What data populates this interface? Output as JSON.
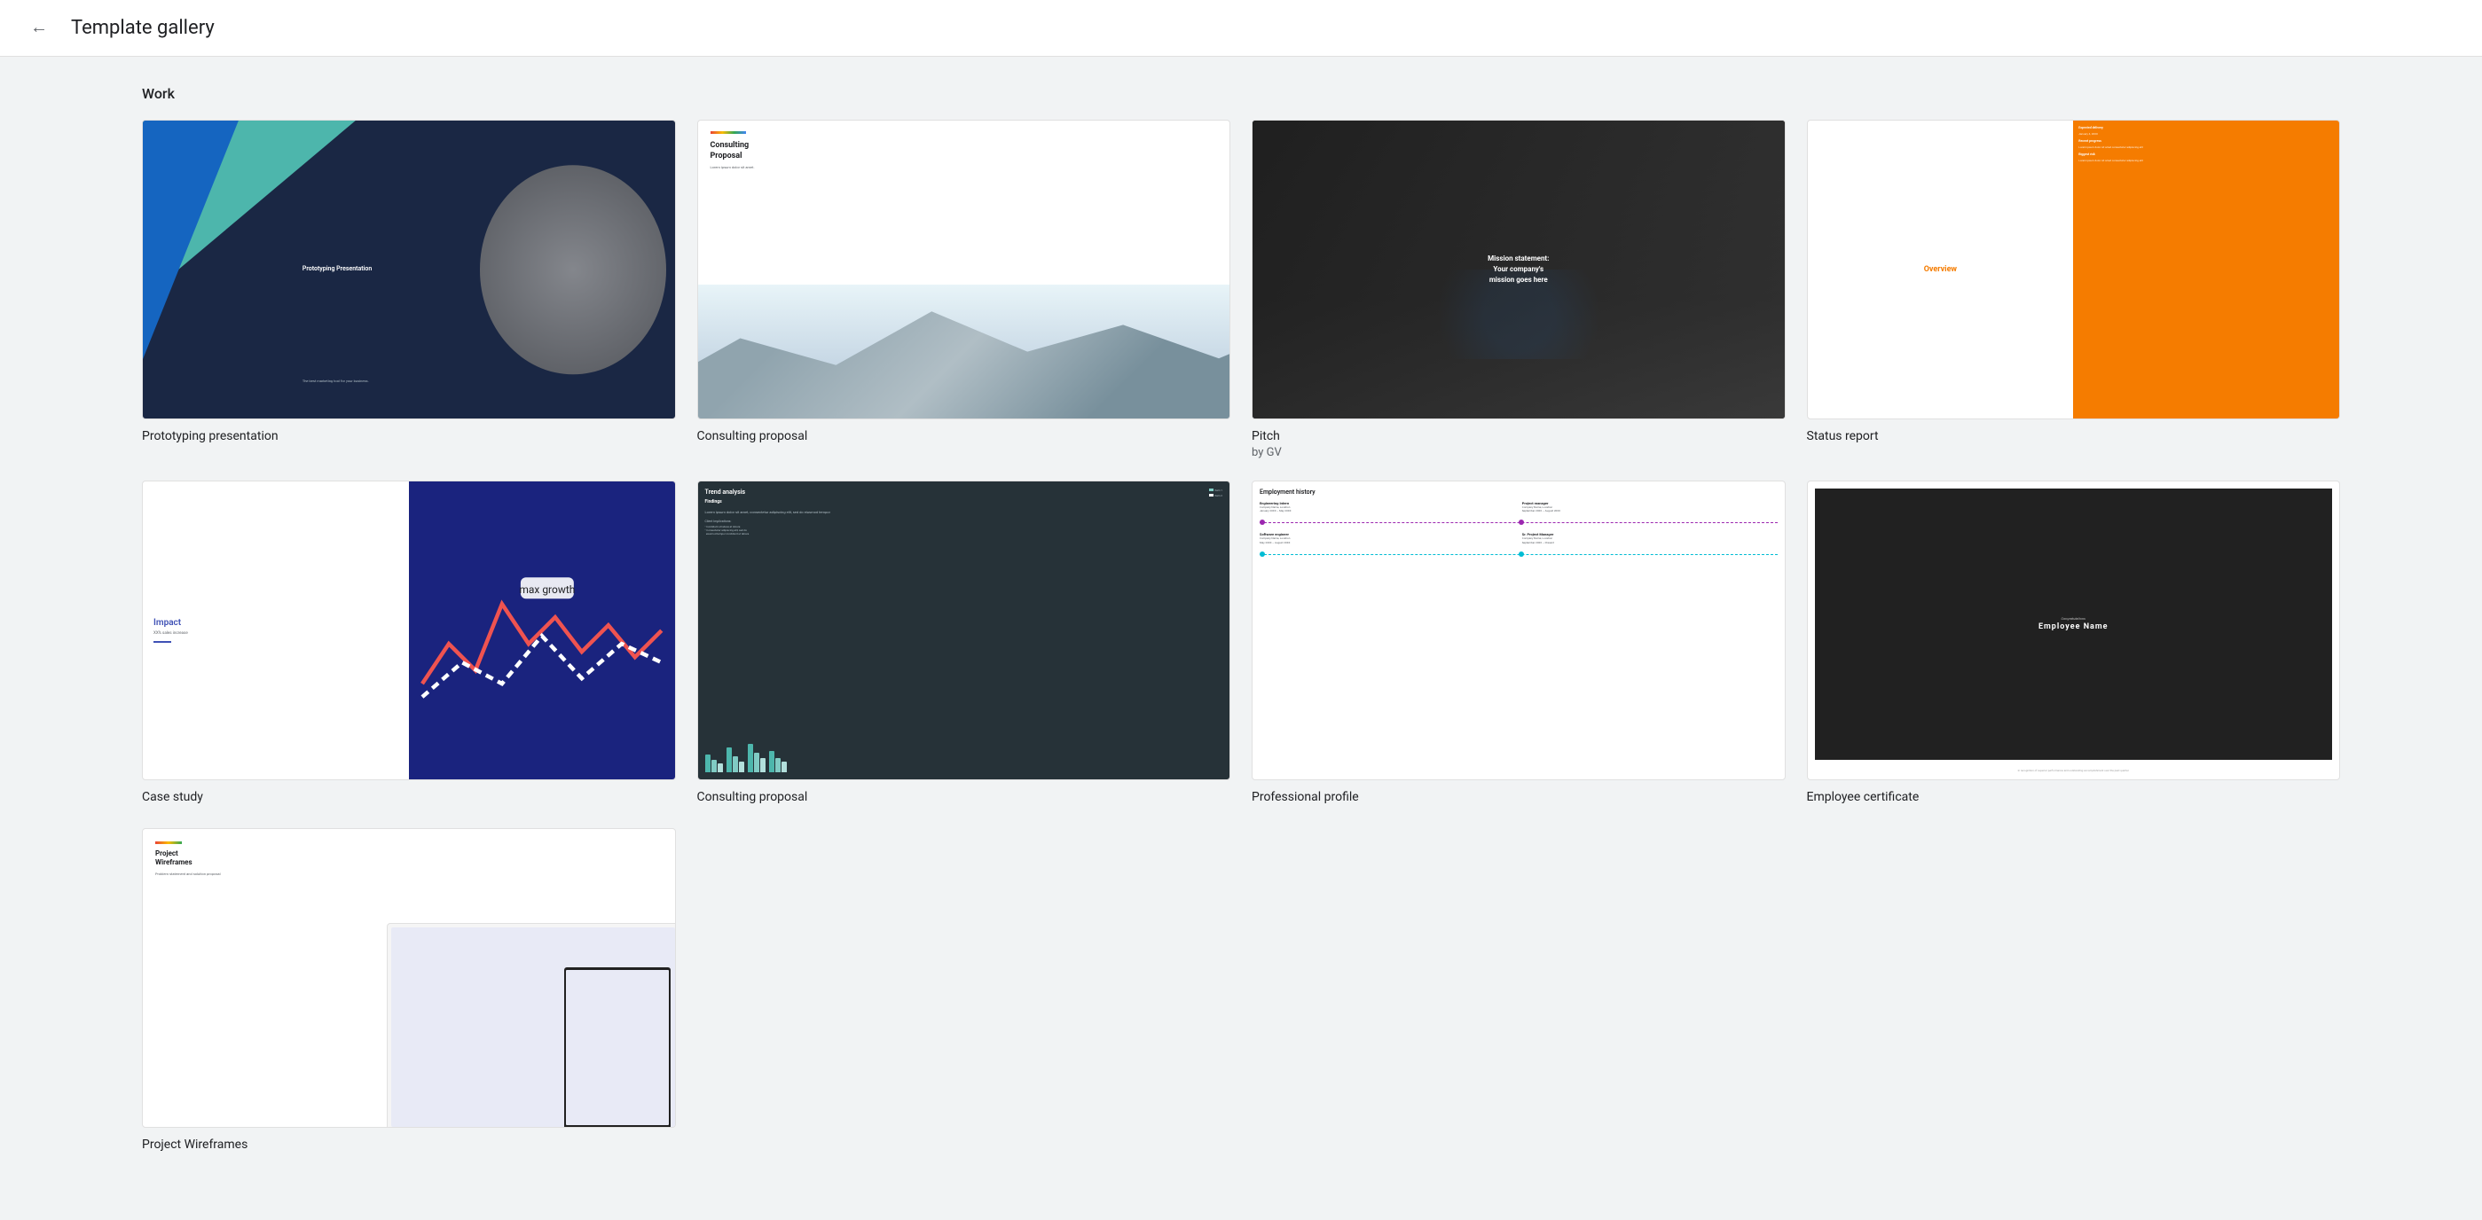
{
  "header": {
    "back_label": "←",
    "title": "Template gallery"
  },
  "section": {
    "work_label": "Work"
  },
  "templates": {
    "row1": [
      {
        "id": "prototyping",
        "label": "Prototyping presentation",
        "sublabel": ""
      },
      {
        "id": "consulting1",
        "label": "Consulting proposal",
        "sublabel": ""
      },
      {
        "id": "pitch",
        "label": "Pitch",
        "sublabel": "by GV"
      },
      {
        "id": "status",
        "label": "Status report",
        "sublabel": ""
      }
    ],
    "row2": [
      {
        "id": "casestudy",
        "label": "Case study",
        "sublabel": ""
      },
      {
        "id": "trend",
        "label": "Consulting proposal",
        "sublabel": ""
      },
      {
        "id": "profile",
        "label": "Professional profile",
        "sublabel": ""
      },
      {
        "id": "cert",
        "label": "Employee certificate",
        "sublabel": ""
      }
    ],
    "row3": [
      {
        "id": "wireframes",
        "label": "Project Wireframes",
        "sublabel": ""
      }
    ]
  },
  "thumb_content": {
    "prototyping": {
      "title": "Prototyping Presentation",
      "sub": "The best marketing tool for your business."
    },
    "consulting1": {
      "title": "Consulting\nProposal",
      "sub": "Lorem ipsum dolor sit amet."
    },
    "pitch": {
      "line1": "Mission statement:",
      "line2": "Your company's",
      "line3": "mission goes here"
    },
    "status": {
      "overview": "Overview",
      "sections": [
        {
          "heading": "Expected delivery",
          "body": "January 4, 20XX"
        },
        {
          "heading": "Recent progress",
          "body": "Lorem ipsum dolor sit amet, consectetur\nadipiscing elit, sed do eiusmod tempor incididunt ut\nlabore et dolore magna aliqua."
        },
        {
          "heading": "Biggest risk",
          "body": "Lorem ipsum dolor sit amet, consectetur\nadipiscing elit."
        }
      ]
    },
    "casestudy": {
      "impact": "Impact",
      "sub": "XX% sales increase"
    },
    "trend": {
      "title": "Trend analysis",
      "findings": "Findings",
      "body": "Lorem ipsum dolor sit amet, consectetur adipiscing elit, sed do eiusmod tempor"
    },
    "profile": {
      "title": "Employment history",
      "roles": [
        {
          "role": "Engineering Intern",
          "details": "Company Name, Location\nJanuary 20XX - May 20XX"
        },
        {
          "role": "Project manager",
          "details": "Company Name, Location\nSeptember 20XX - August 20XX"
        },
        {
          "role": "Software engineer",
          "details": "Company Name, Location\nMay 20XX - August 20XX"
        },
        {
          "role": "Sr. Project Manager",
          "details": "Company Name, Location\nSeptember 20XX - Present"
        }
      ]
    },
    "cert": {
      "congrats": "Congratulations",
      "name": "Employee Name",
      "sub": "In recognition of superior performance and outstanding\naccomplishment over the past quarter"
    },
    "wireframes": {
      "title": "Project\nWireframes",
      "sub": "Problem statement and\nsolution proposal"
    }
  }
}
